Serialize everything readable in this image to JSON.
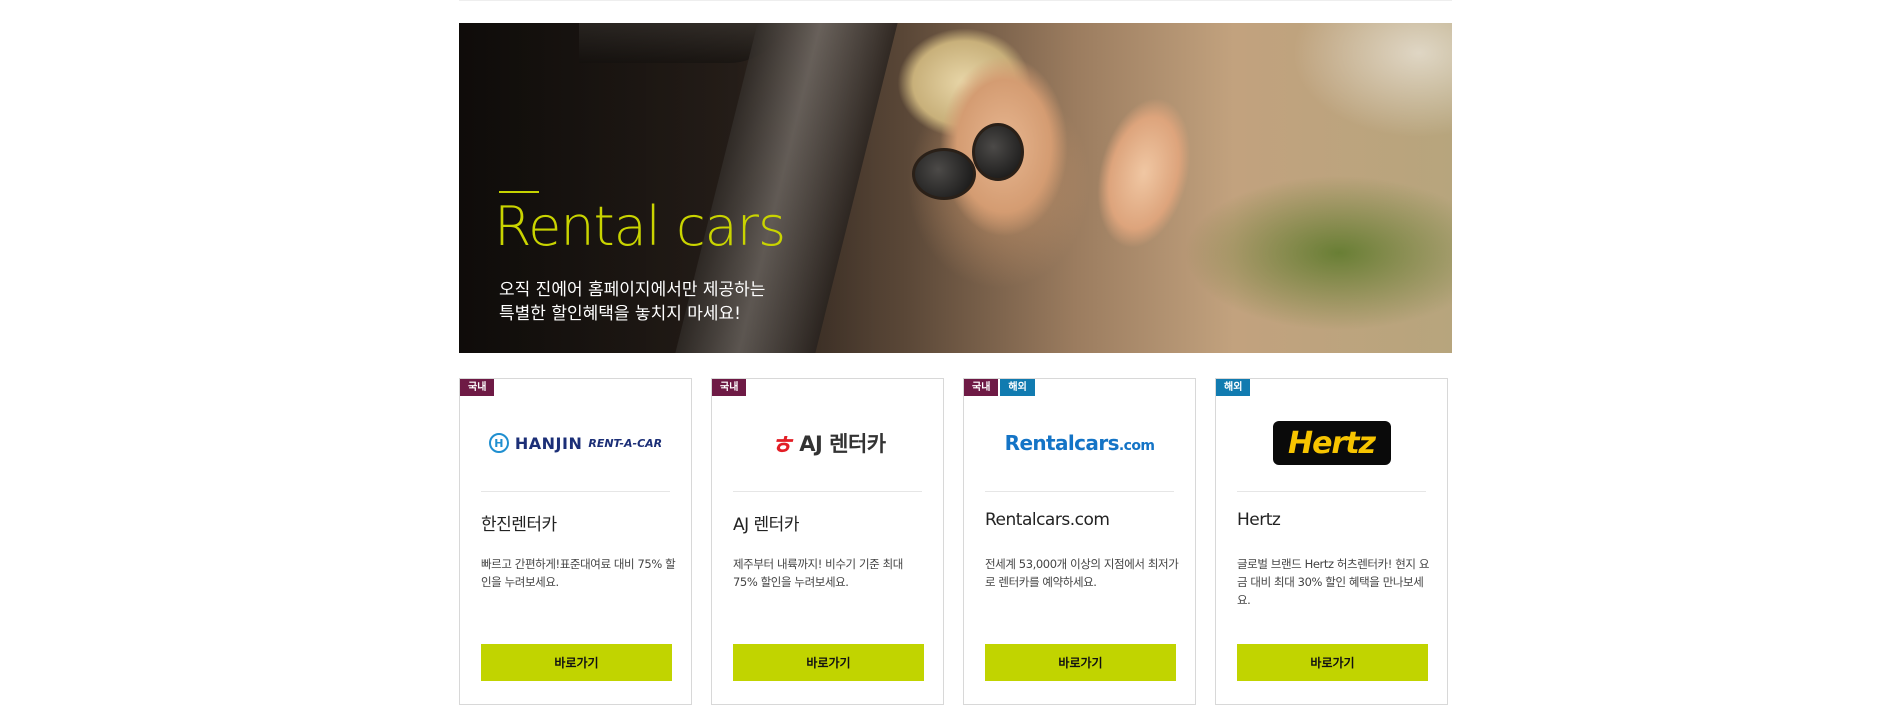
{
  "hero": {
    "title": "Rental cars",
    "subtitle_line1": "오직 진에어 홈페이지에서만 제공하는",
    "subtitle_line2": "특별한 할인혜택을 놓치지 마세요!"
  },
  "colors": {
    "accent": "#c1d400",
    "badge_domestic": "#6e1a45",
    "badge_overseas": "#117bb0"
  },
  "cards": [
    {
      "badges": [
        "국내"
      ],
      "logo": {
        "mark": "H",
        "text": "HANJIN",
        "sub": "RENT-A-CAR"
      },
      "name": "한진렌터카",
      "description": "빠르고 간편하게!표준대여료 대비 75% 할인을 누려보세요.",
      "button_label": "바로가기"
    },
    {
      "badges": [
        "국내"
      ],
      "logo": {
        "mark": "ㅎ",
        "text": "AJ 렌터카"
      },
      "name": "AJ 렌터카",
      "description": "제주부터 내륙까지! 비수기 기준 최대 75% 할인을 누려보세요.",
      "button_label": "바로가기"
    },
    {
      "badges": [
        "국내",
        "해외"
      ],
      "logo": {
        "text": "Rentalcars",
        "suffix": ".com"
      },
      "name": "Rentalcars.com",
      "description": "전세계 53,000개 이상의 지점에서 최저가로 렌터카를 예약하세요.",
      "button_label": "바로가기"
    },
    {
      "badges": [
        "해외"
      ],
      "logo": {
        "text": "Hertz"
      },
      "name": "Hertz",
      "description": "글로벌 브랜드 Hertz 허츠렌터카! 현지 요금 대비 최대 30% 할인 혜택을 만나보세요.",
      "button_label": "바로가기"
    }
  ]
}
